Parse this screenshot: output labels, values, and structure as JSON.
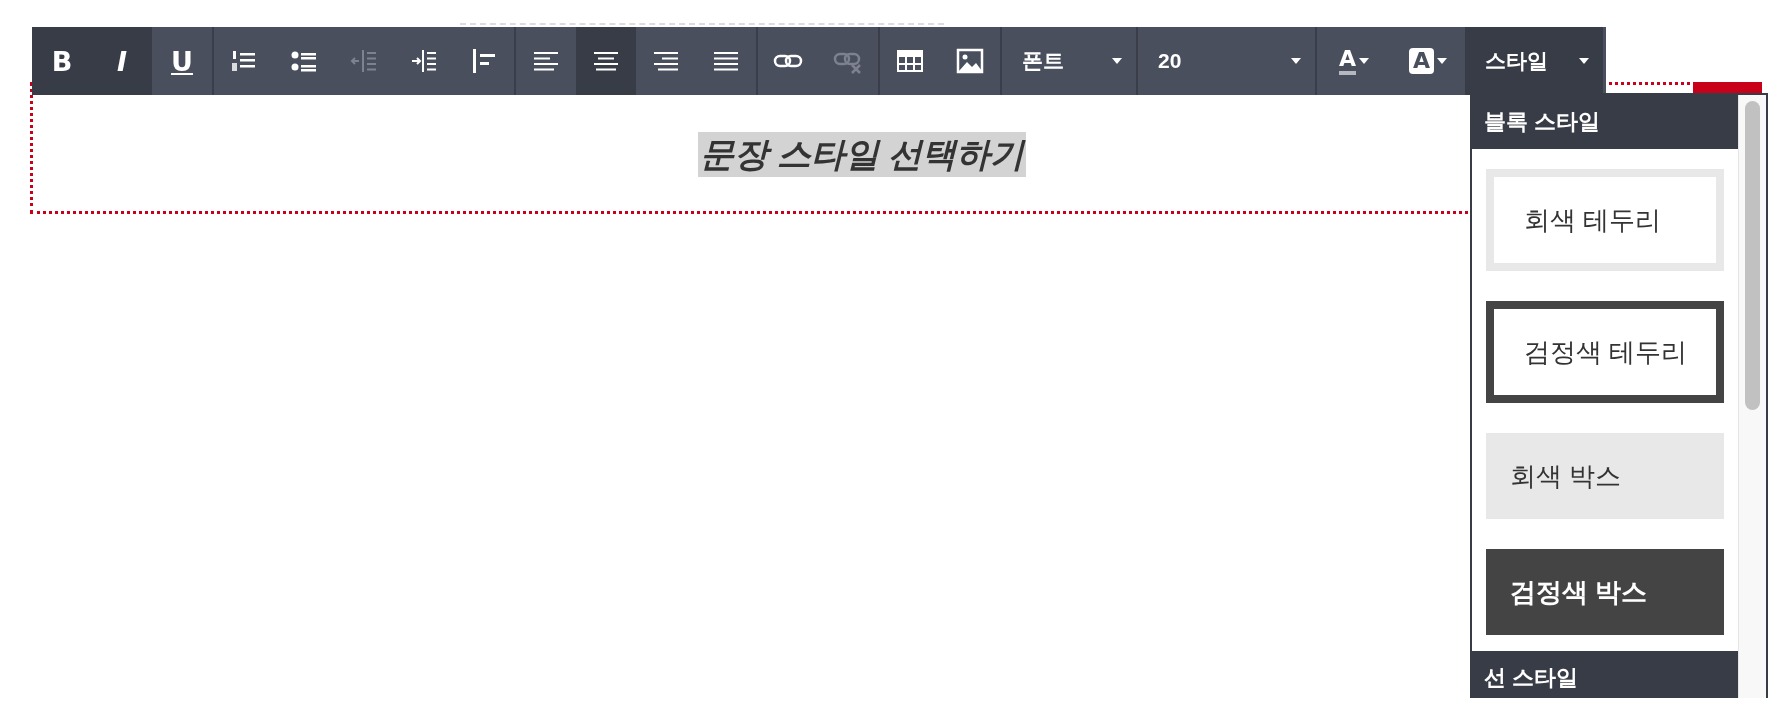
{
  "toolbar": {
    "groups": [
      {
        "buttons": [
          {
            "kind": "bold",
            "label": "B",
            "active": true,
            "disabled": false
          },
          {
            "kind": "italic",
            "label": "I",
            "active": true,
            "disabled": false
          },
          {
            "kind": "underline",
            "label": "U",
            "active": false,
            "disabled": false
          }
        ]
      },
      {
        "buttons": [
          {
            "kind": "ordered-list",
            "active": false,
            "disabled": false
          },
          {
            "kind": "bullet-list",
            "active": false,
            "disabled": false
          },
          {
            "kind": "outdent",
            "active": false,
            "disabled": true
          },
          {
            "kind": "indent",
            "active": false,
            "disabled": false
          },
          {
            "kind": "blockquote",
            "active": false,
            "disabled": false
          }
        ]
      },
      {
        "buttons": [
          {
            "kind": "align-left",
            "active": false,
            "disabled": false
          },
          {
            "kind": "align-center",
            "active": true,
            "disabled": false
          },
          {
            "kind": "align-right",
            "active": false,
            "disabled": false
          },
          {
            "kind": "align-justify",
            "active": false,
            "disabled": false
          }
        ]
      },
      {
        "buttons": [
          {
            "kind": "link",
            "active": false,
            "disabled": false
          },
          {
            "kind": "unlink",
            "active": false,
            "disabled": true
          }
        ]
      },
      {
        "buttons": [
          {
            "kind": "table",
            "active": false,
            "disabled": false
          },
          {
            "kind": "image",
            "active": false,
            "disabled": false
          }
        ]
      }
    ],
    "font_select": {
      "value": "폰트"
    },
    "size_select": {
      "value": "20"
    },
    "color_buttons": [
      {
        "kind": "text-color",
        "label": "A"
      },
      {
        "kind": "background-color",
        "label": "A"
      }
    ],
    "style_select": {
      "value": "스타일",
      "expanded": true
    }
  },
  "editor": {
    "heading": "문장 스타일 선택하기"
  },
  "style_menu": {
    "sections": [
      {
        "title": "블록 스타일",
        "items": [
          {
            "kind": "gray-border",
            "label": "회색 테두리"
          },
          {
            "kind": "black-border",
            "label": "검정색 테두리"
          },
          {
            "kind": "gray-box",
            "label": "회색 박스"
          },
          {
            "kind": "black-box",
            "label": "검정색 박스"
          }
        ]
      },
      {
        "title": "선 스타일"
      }
    ]
  }
}
